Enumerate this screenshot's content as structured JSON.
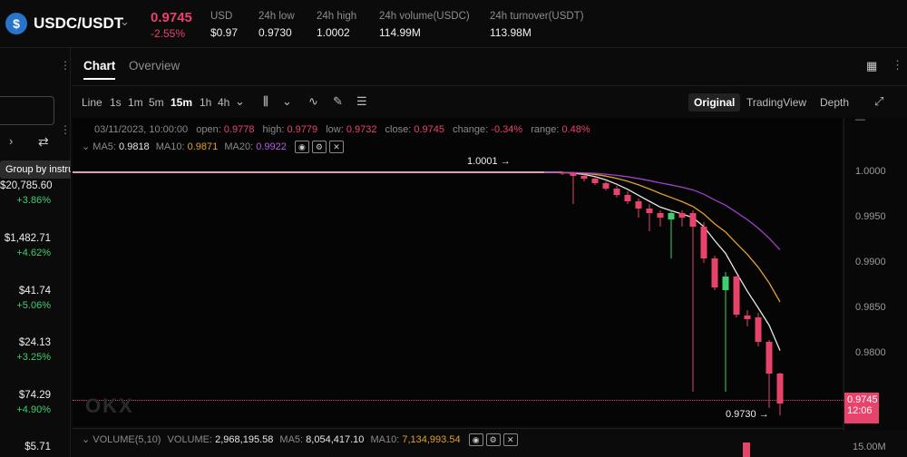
{
  "header": {
    "pair": "USDC/USDT",
    "last_price": "0.9745",
    "change_pct": "-2.55%",
    "stats": [
      {
        "label": "USD",
        "value": "$0.97"
      },
      {
        "label": "24h low",
        "value": "0.9730"
      },
      {
        "label": "24h high",
        "value": "1.0002"
      },
      {
        "label": "24h volume(USDC)",
        "value": "114.99M"
      },
      {
        "label": "24h turnover(USDT)",
        "value": "113.98M"
      }
    ]
  },
  "sidebar": {
    "tooltip": "Group by instrument",
    "items": [
      {
        "price": "$20,785.60",
        "change": "+3.86%"
      },
      {
        "price": "$1,482.71",
        "change": "+4.62%"
      },
      {
        "price": "$41.74",
        "change": "+5.06%"
      },
      {
        "price": "$24.13",
        "change": "+3.25%"
      },
      {
        "price": "$74.29",
        "change": "+4.90%"
      },
      {
        "price": "$5.71",
        "change": ""
      }
    ]
  },
  "tabs": [
    "Chart",
    "Overview"
  ],
  "toolbar": {
    "intervals": [
      "Line",
      "1s",
      "1m",
      "5m",
      "15m",
      "1h",
      "4h"
    ],
    "active_interval": "15m",
    "views": [
      "Original",
      "TradingView",
      "Depth"
    ],
    "active_view": "Original"
  },
  "ohlc": {
    "time": "03/11/2023, 10:00:00",
    "open_label": "open:",
    "open": "0.9778",
    "high_label": "high:",
    "high": "0.9779",
    "low_label": "low:",
    "low": "0.9732",
    "close_label": "close:",
    "close": "0.9745",
    "change_label": "change:",
    "change": "-0.34%",
    "range_label": "range:",
    "range": "0.48%"
  },
  "ma": {
    "ma5_label": "MA5:",
    "ma5": "0.9818",
    "ma10_label": "MA10:",
    "ma10": "0.9871",
    "ma20_label": "MA20:",
    "ma20": "0.9922"
  },
  "annotations": {
    "high_mark": "1.0001",
    "low_mark": "0.9730",
    "current_price": "0.9745",
    "countdown": "12:06"
  },
  "volume": {
    "label": "VOLUME(5,10)",
    "vol_label": "VOLUME:",
    "vol": "2,968,195.58",
    "ma5_label": "MA5:",
    "ma5": "8,054,417.10",
    "ma10_label": "MA10:",
    "ma10": "7,134,993.54",
    "axis_tick": "15.00M"
  },
  "watermark": "OKX",
  "colors": {
    "up": "#3fcf70",
    "down": "#e8436b",
    "ma5": "#e6e6e6",
    "ma10": "#e0a030",
    "ma20": "#a040c8"
  },
  "chart_data": {
    "type": "candlestick",
    "y_ticks": [
      "1.0000",
      "0.9950",
      "0.9900",
      "0.9850",
      "0.9800"
    ],
    "ylim": [
      0.972,
      1.003
    ],
    "candles": [
      {
        "o": 1.0,
        "h": 1.0001,
        "l": 0.9997,
        "c": 0.9999
      },
      {
        "o": 0.9999,
        "h": 1.0,
        "l": 0.9965,
        "c": 0.9996
      },
      {
        "o": 0.9996,
        "h": 0.9998,
        "l": 0.999,
        "c": 0.9993
      },
      {
        "o": 0.9993,
        "h": 0.9995,
        "l": 0.9986,
        "c": 0.9988
      },
      {
        "o": 0.9988,
        "h": 0.999,
        "l": 0.998,
        "c": 0.9982
      },
      {
        "o": 0.9982,
        "h": 0.9985,
        "l": 0.9972,
        "c": 0.9975
      },
      {
        "o": 0.9975,
        "h": 0.9979,
        "l": 0.9965,
        "c": 0.9968
      },
      {
        "o": 0.9968,
        "h": 0.9971,
        "l": 0.995,
        "c": 0.996
      },
      {
        "o": 0.996,
        "h": 0.9965,
        "l": 0.9935,
        "c": 0.9955
      },
      {
        "o": 0.9955,
        "h": 0.9958,
        "l": 0.994,
        "c": 0.995
      },
      {
        "o": 0.9948,
        "h": 0.9958,
        "l": 0.9905,
        "c": 0.9955
      },
      {
        "o": 0.9955,
        "h": 0.9958,
        "l": 0.994,
        "c": 0.995
      },
      {
        "o": 0.9955,
        "h": 0.9958,
        "l": 0.9758,
        "c": 0.994
      },
      {
        "o": 0.994,
        "h": 0.9945,
        "l": 0.99,
        "c": 0.9905
      },
      {
        "o": 0.9905,
        "h": 0.9908,
        "l": 0.987,
        "c": 0.9873
      },
      {
        "o": 0.987,
        "h": 0.989,
        "l": 0.9758,
        "c": 0.9885
      },
      {
        "o": 0.9885,
        "h": 0.9886,
        "l": 0.984,
        "c": 0.9843
      },
      {
        "o": 0.9842,
        "h": 0.9848,
        "l": 0.983,
        "c": 0.9838
      },
      {
        "o": 0.984,
        "h": 0.9845,
        "l": 0.9808,
        "c": 0.9813
      },
      {
        "o": 0.9813,
        "h": 0.9815,
        "l": 0.974,
        "c": 0.9778
      },
      {
        "o": 0.9778,
        "h": 0.9779,
        "l": 0.9732,
        "c": 0.9745
      }
    ]
  }
}
